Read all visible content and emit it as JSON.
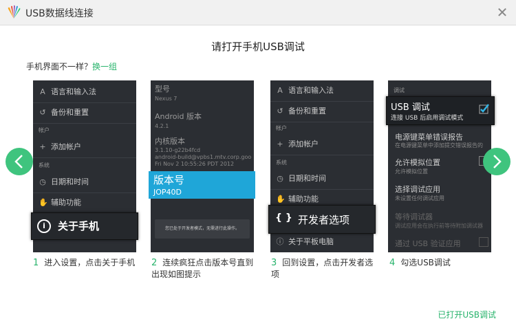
{
  "window": {
    "title": "USB数据线连接",
    "close_glyph": "✕"
  },
  "heading": "请打开手机USB调试",
  "subline": {
    "question": "手机界面不一样？",
    "link": "换一组"
  },
  "phone1": {
    "rows": [
      "语言和输入法",
      "备份和重置",
      "添加帐户",
      "日期和时间",
      "辅助功能"
    ],
    "sections": [
      "帐户",
      "系统"
    ],
    "popout": "关于手机"
  },
  "phone2": {
    "model_label": "型号",
    "model_value": "Nexus 7",
    "android_label": "Android 版本",
    "android_value": "4.2.1",
    "kernel_label": "内核版本",
    "kernel_lines": [
      "3.1.10-g22b4fcd",
      "android-build@vpbs1.mtv.corp.goo",
      "Fri Nov 2 10:55:26 PDT 2012"
    ],
    "build_label": "版本号",
    "build_value": "JOP40D",
    "toast": "您已处于开发者模式，无需进行此操作。"
  },
  "phone3": {
    "rows": [
      "语言和输入法",
      "备份和重置",
      "添加帐户",
      "日期和时间",
      "辅助功能",
      "关于平板电脑"
    ],
    "sections": [
      "帐户",
      "系统"
    ],
    "popout_icon": "{ }",
    "popout": "开发者选项"
  },
  "phone4": {
    "section": "调试",
    "usb_title": "USB 调试",
    "usb_desc": "连接 USB 后启用调试模式",
    "items": [
      {
        "title": "电源键菜单错误报告",
        "desc": "在电源键菜单中添加提交错误报告的"
      },
      {
        "title": "允许模拟位置",
        "desc": "允许模拟位置"
      },
      {
        "title": "选择调试应用",
        "desc": "未设置任何调试应用"
      },
      {
        "title": "等待调试器",
        "desc": "调试应用会在执行前等待附加调试器"
      },
      {
        "title": "通过 USB 验证应用",
        "desc": ""
      }
    ]
  },
  "steps": [
    {
      "num": "1",
      "text": "进入设置，点击关于手机"
    },
    {
      "num": "2",
      "text": "连续疯狂点击版本号直到出现如图提示"
    },
    {
      "num": "3",
      "text": "回到设置，点击开发者选项"
    },
    {
      "num": "4",
      "text": "勾选USB调试"
    }
  ],
  "done_link": "已打开USB调试",
  "colors": {
    "accent": "#3fc47e",
    "link": "#27b36b",
    "highlight": "#1fa6d8"
  }
}
